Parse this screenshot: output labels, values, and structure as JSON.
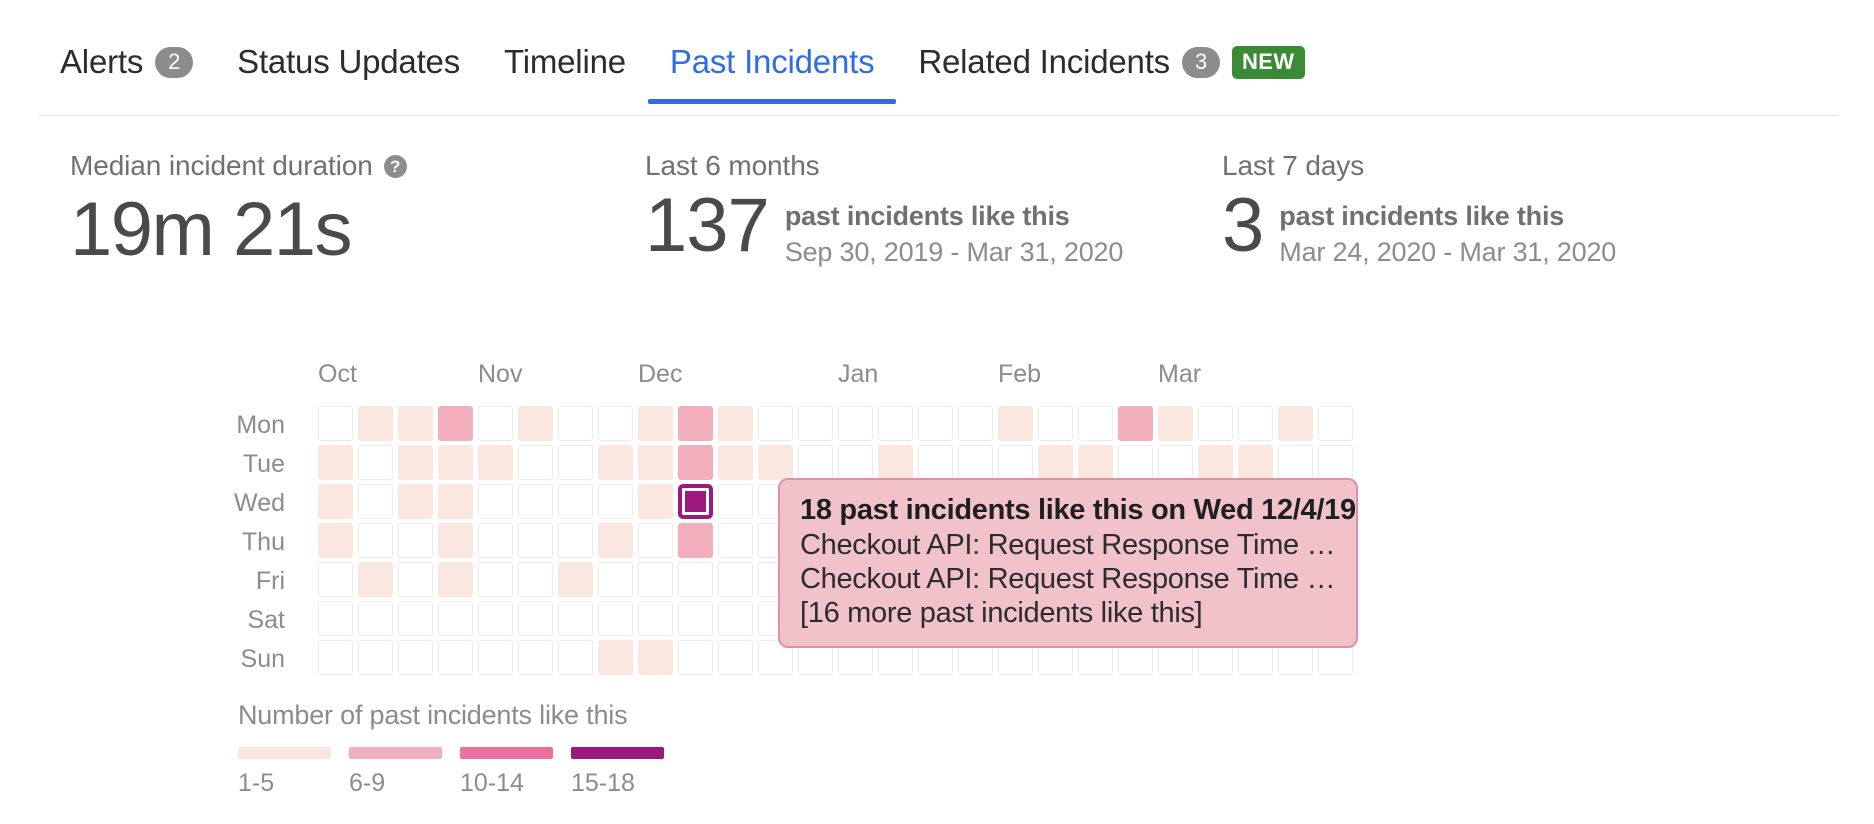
{
  "tabs": [
    {
      "id": "alerts",
      "label": "Alerts",
      "count": "2",
      "active": false,
      "new": false
    },
    {
      "id": "status-updates",
      "label": "Status Updates",
      "count": null,
      "active": false,
      "new": false
    },
    {
      "id": "timeline",
      "label": "Timeline",
      "count": null,
      "active": false,
      "new": false
    },
    {
      "id": "past-incidents",
      "label": "Past Incidents",
      "count": null,
      "active": true,
      "new": false
    },
    {
      "id": "related-incidents",
      "label": "Related Incidents",
      "count": "3",
      "active": false,
      "new": true,
      "new_label": "NEW"
    }
  ],
  "stats": {
    "median": {
      "label": "Median incident duration",
      "help_icon": "help-circle-icon",
      "value": "19m 21s"
    },
    "six_months": {
      "label": "Last 6 months",
      "number": "137",
      "title": "past incidents like this",
      "range": "Sep 30, 2019 - Mar 31, 2020"
    },
    "seven_days": {
      "label": "Last 7 days",
      "number": "3",
      "title": "past incidents like this",
      "range": "Mar 24, 2020 - Mar 31, 2020"
    }
  },
  "heatmap": {
    "months": [
      {
        "label": "Oct",
        "col": 0
      },
      {
        "label": "Nov",
        "col": 4
      },
      {
        "label": "Dec",
        "col": 8
      },
      {
        "label": "Jan",
        "col": 13
      },
      {
        "label": "Feb",
        "col": 17
      },
      {
        "label": "Mar",
        "col": 21
      }
    ],
    "days": [
      "Mon",
      "Tue",
      "Wed",
      "Thu",
      "Fri",
      "Sat",
      "Sun"
    ],
    "columns": 26,
    "selected": {
      "day": "Wed",
      "col": 9
    },
    "colors": {
      "empty": "#ffffff",
      "b1": "#fae7e0",
      "b2": "#f2aebc",
      "b3": "#ec6f9c",
      "b4": "#9c1a7d",
      "border": "#ececec",
      "selected_ring": "#9c1a7d"
    },
    "values": [
      [
        0,
        1,
        1,
        2,
        0,
        1,
        0,
        0,
        1,
        2,
        1,
        0,
        0,
        0,
        0,
        0,
        0,
        1,
        0,
        0,
        2,
        1,
        0,
        0,
        1,
        0
      ],
      [
        1,
        0,
        1,
        1,
        1,
        0,
        0,
        1,
        1,
        2,
        1,
        1,
        0,
        0,
        1,
        0,
        0,
        0,
        1,
        1,
        0,
        0,
        1,
        1,
        0,
        0
      ],
      [
        1,
        0,
        1,
        1,
        0,
        0,
        0,
        0,
        1,
        4,
        0,
        0,
        0,
        0,
        0,
        0,
        0,
        0,
        0,
        0,
        0,
        0,
        0,
        0,
        0,
        0
      ],
      [
        1,
        0,
        0,
        1,
        0,
        0,
        0,
        1,
        0,
        2,
        0,
        0,
        0,
        0,
        0,
        0,
        0,
        0,
        0,
        0,
        0,
        0,
        0,
        0,
        0,
        0
      ],
      [
        0,
        1,
        0,
        1,
        0,
        0,
        1,
        0,
        0,
        0,
        0,
        0,
        0,
        0,
        0,
        0,
        0,
        0,
        0,
        0,
        0,
        1,
        0,
        1,
        0,
        0
      ],
      [
        0,
        0,
        0,
        0,
        0,
        0,
        0,
        0,
        0,
        0,
        0,
        0,
        0,
        0,
        0,
        0,
        0,
        0,
        0,
        0,
        0,
        0,
        0,
        0,
        0,
        0
      ],
      [
        0,
        0,
        0,
        0,
        0,
        0,
        0,
        1,
        1,
        0,
        0,
        0,
        0,
        0,
        0,
        0,
        0,
        0,
        0,
        0,
        0,
        0,
        0,
        0,
        0,
        0
      ]
    ]
  },
  "tooltip": {
    "title": "18 past incidents like this on Wed 12/4/19",
    "lines": [
      "Checkout API: Request Response Time i...",
      "Checkout API: Request Response Time i...",
      "[16 more past incidents like this]"
    ]
  },
  "legend": {
    "title": "Number of past incidents like this",
    "items": [
      {
        "label": "1-5",
        "color": "#fae7e0"
      },
      {
        "label": "6-9",
        "color": "#f2aebc"
      },
      {
        "label": "10-14",
        "color": "#ec6f9c"
      },
      {
        "label": "15-18",
        "color": "#9c1a7d"
      }
    ]
  }
}
